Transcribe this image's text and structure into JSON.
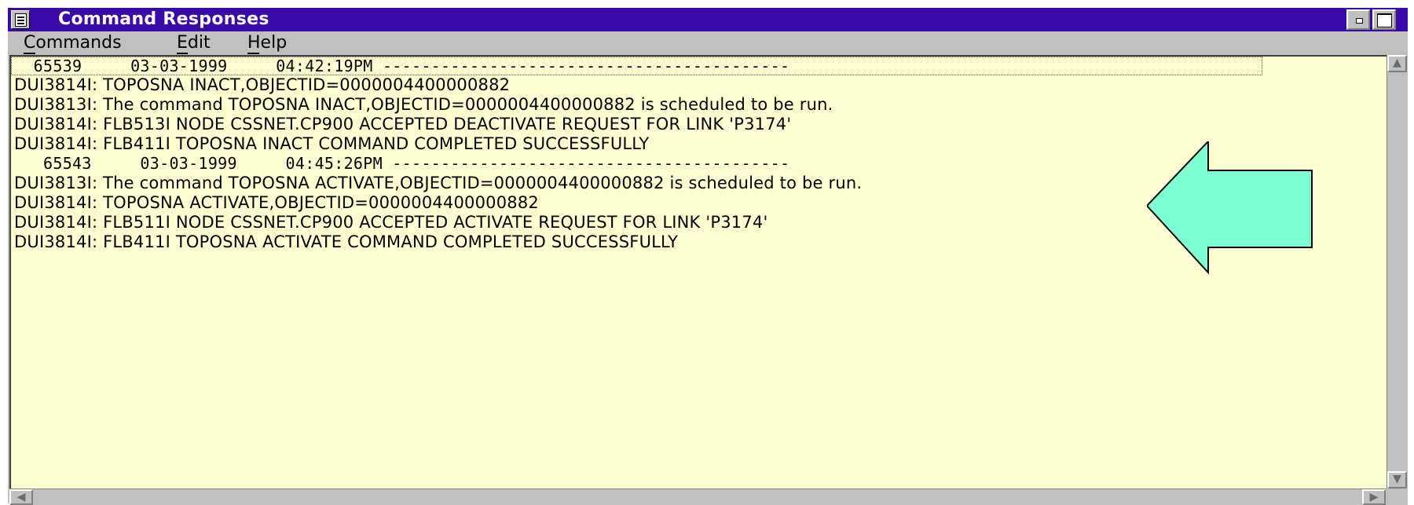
{
  "window": {
    "title": "Command Responses",
    "icons": {
      "system_menu": "document-icon",
      "minimize": "minimize-icon",
      "maximize": "maximize-icon"
    }
  },
  "menu": [
    {
      "label": "Commands",
      "mnemonic": "C"
    },
    {
      "label": "Edit",
      "mnemonic": "E"
    },
    {
      "label": "Help",
      "mnemonic": "H"
    }
  ],
  "log": [
    {
      "kind": "header",
      "text": "  65539     03-03-1999     04:42:19PM ------------------------------------------"
    },
    {
      "kind": "msg",
      "text": "DUI3814I: TOPOSNA INACT,OBJECTID=0000004400000882"
    },
    {
      "kind": "msg",
      "text": "DUI3813I: The command TOPOSNA INACT,OBJECTID=0000004400000882 is scheduled to be run."
    },
    {
      "kind": "msg",
      "text": "DUI3814I: FLB513I NODE CSSNET.CP900 ACCEPTED DEACTIVATE REQUEST FOR LINK 'P3174'"
    },
    {
      "kind": "msg",
      "text": "DUI3814I: FLB411I TOPOSNA INACT COMMAND COMPLETED SUCCESSFULLY"
    },
    {
      "kind": "header",
      "text": "   65543     03-03-1999     04:45:26PM -----------------------------------------"
    },
    {
      "kind": "msg",
      "text": "DUI3813I: The command TOPOSNA ACTIVATE,OBJECTID=0000004400000882 is scheduled to be run."
    },
    {
      "kind": "msg",
      "text": "DUI3814I: TOPOSNA ACTIVATE,OBJECTID=0000004400000882"
    },
    {
      "kind": "msg",
      "text": "DUI3814I: FLB511I NODE CSSNET.CP900 ACCEPTED ACTIVATE REQUEST FOR LINK 'P3174'"
    },
    {
      "kind": "msg",
      "text": "DUI3814I: FLB411I TOPOSNA ACTIVATE COMMAND COMPLETED SUCCESSFULLY"
    }
  ],
  "scrollbars": {
    "up": "▲",
    "down": "▼",
    "left": "◀",
    "right": "▶"
  },
  "colors": {
    "title_bar": "#3a0aa8",
    "log_background": "#ffffd2",
    "annotation_arrow": "#7fffd4"
  },
  "annotation": {
    "icon": "left-arrow-icon"
  }
}
